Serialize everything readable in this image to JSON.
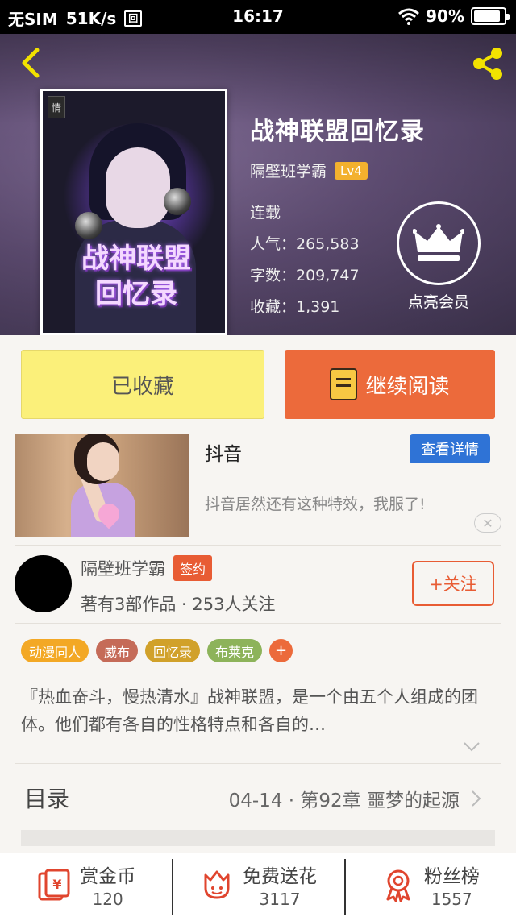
{
  "status_bar": {
    "carrier": "无SIM",
    "speed": "51K/s",
    "time": "16:17",
    "battery": "90%",
    "battery_level": 0.9
  },
  "book": {
    "cover_badge": "情",
    "cover_title_line1": "战神联盟",
    "cover_title_line2": "回忆录",
    "title": "战神联盟回忆录",
    "author": "隔壁班学霸",
    "level": "Lv4",
    "status": "连载",
    "popularity": "人气：265,583",
    "word_count": "字数：209,747",
    "favorites": "收藏：1,391"
  },
  "vip": {
    "label": "点亮会员"
  },
  "actions": {
    "favorited_label": "已收藏",
    "continue_label": "继续阅读"
  },
  "ad": {
    "title": "抖音",
    "button": "查看详情",
    "description": "抖音居然还有这种特效，我服了!",
    "close": "✕"
  },
  "author_card": {
    "name": "隔壁班学霸",
    "badge": "签约",
    "stats": "著有3部作品 · 253人关注",
    "follow": "+关注"
  },
  "tags": [
    {
      "label": "动漫同人",
      "color": "#f3a825"
    },
    {
      "label": "威布",
      "color": "#c56b58"
    },
    {
      "label": "回忆录",
      "color": "#d1a12a"
    },
    {
      "label": "布莱克",
      "color": "#8db35a"
    }
  ],
  "tag_more": "+",
  "tag_more_color": "#ec6a3b",
  "description": "『热血奋斗，慢热清水』战神联盟，是一个由五个人组成的团体。他们都有各自的性格特点和各自的…",
  "toc": {
    "label": "目录",
    "latest": "04-14 · 第92章 噩梦的起源"
  },
  "bottom_bar": [
    {
      "label": "赏金币",
      "count": "120",
      "icon": "red-envelope-icon"
    },
    {
      "label": "免费送花",
      "count": "3117",
      "icon": "flower-icon"
    },
    {
      "label": "粉丝榜",
      "count": "1557",
      "icon": "medal-icon"
    }
  ],
  "colors": {
    "accent": "#ec6a3b",
    "fav_button": "#fbf07a",
    "ad_button": "#2f73d6"
  }
}
